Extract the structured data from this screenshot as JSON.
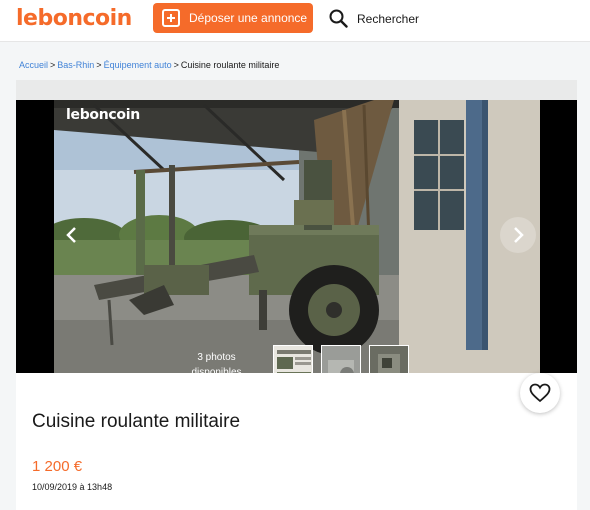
{
  "header": {
    "logo": "leboncoin",
    "post_button": "Déposer une annonce",
    "search_label": "Rechercher"
  },
  "breadcrumb": [
    {
      "label": "Accueil"
    },
    {
      "label": "Bas-Rhin"
    },
    {
      "label": "Équipement auto"
    },
    {
      "label": "Cuisine roulante militaire"
    }
  ],
  "gallery": {
    "watermark": "leboncoin",
    "photos_count_line1": "3 photos",
    "photos_count_line2": "disponibles",
    "thumbnail_count": 3
  },
  "listing": {
    "title": "Cuisine roulante militaire",
    "price": "1 200 €",
    "date": "10/09/2019 à 13h48"
  },
  "colors": {
    "brand": "#f56b2a",
    "link": "#4183d7"
  },
  "icons": [
    "plus-square-icon",
    "search-icon",
    "chevron-left-icon",
    "chevron-right-icon",
    "heart-icon"
  ]
}
